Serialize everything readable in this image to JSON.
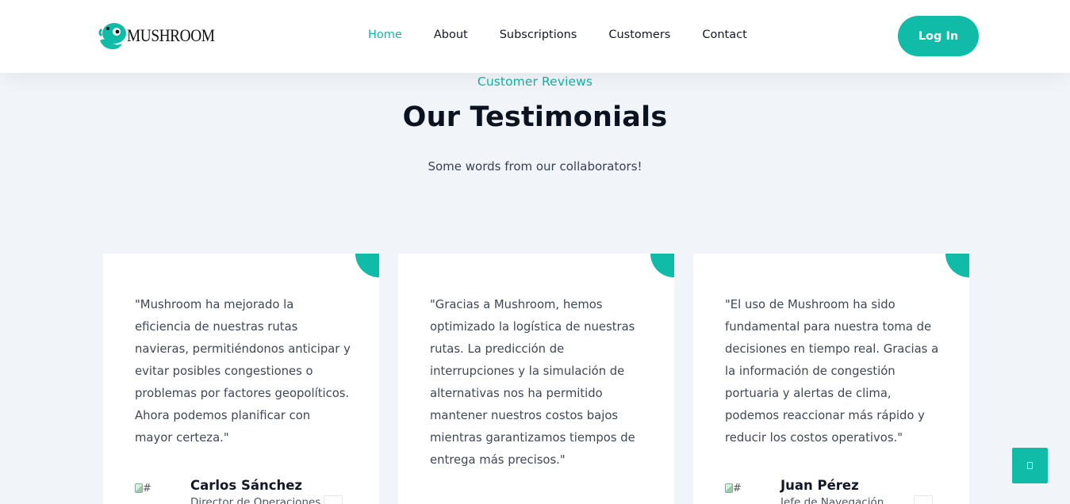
{
  "brand": {
    "name": "MUSHROOM",
    "accent": "#10bba7"
  },
  "nav": {
    "links": [
      {
        "label": "Home",
        "active": true
      },
      {
        "label": "About",
        "active": false
      },
      {
        "label": "Subscriptions",
        "active": false
      },
      {
        "label": "Customers",
        "active": false
      },
      {
        "label": "Contact",
        "active": false
      }
    ],
    "login_label": "Log In"
  },
  "section": {
    "eyebrow": "Customer Reviews",
    "title": "Our Testimonials",
    "subtitle": "Some words from our collaborators!"
  },
  "testimonials": [
    {
      "quote": "\"Mushroom ha mejorado la eficiencia de nuestras rutas navieras, permitiéndonos anticipar y evitar posibles congestiones o problemas por factores geopolíticos. Ahora podemos planificar con mayor certeza.\"",
      "avatar_alt": "#",
      "name": "Carlos Sánchez",
      "role": "Director de Operaciones"
    },
    {
      "quote": "\"Gracias a Mushroom, hemos optimizado la logística de nuestras rutas. La predicción de interrupciones y la simulación de alternativas nos ha permitido mantener nuestros costos bajos mientras garantizamos tiempos de entrega más precisos.\"",
      "avatar_alt": "",
      "name": "",
      "role": ""
    },
    {
      "quote": "\"El uso de Mushroom ha sido fundamental para nuestra toma de decisiones en tiempo real. Gracias a la información de congestión portuaria y alertas de clima, podemos reaccionar más rápido y reducir los costos operativos.\"",
      "avatar_alt": "#",
      "name": "Juan Pérez",
      "role": "Jefe de Navegación"
    }
  ],
  "icons": {
    "logo": "mushroom-mascot-icon",
    "scroll_top": "arrow-up-icon",
    "quote": "quote-icon"
  }
}
